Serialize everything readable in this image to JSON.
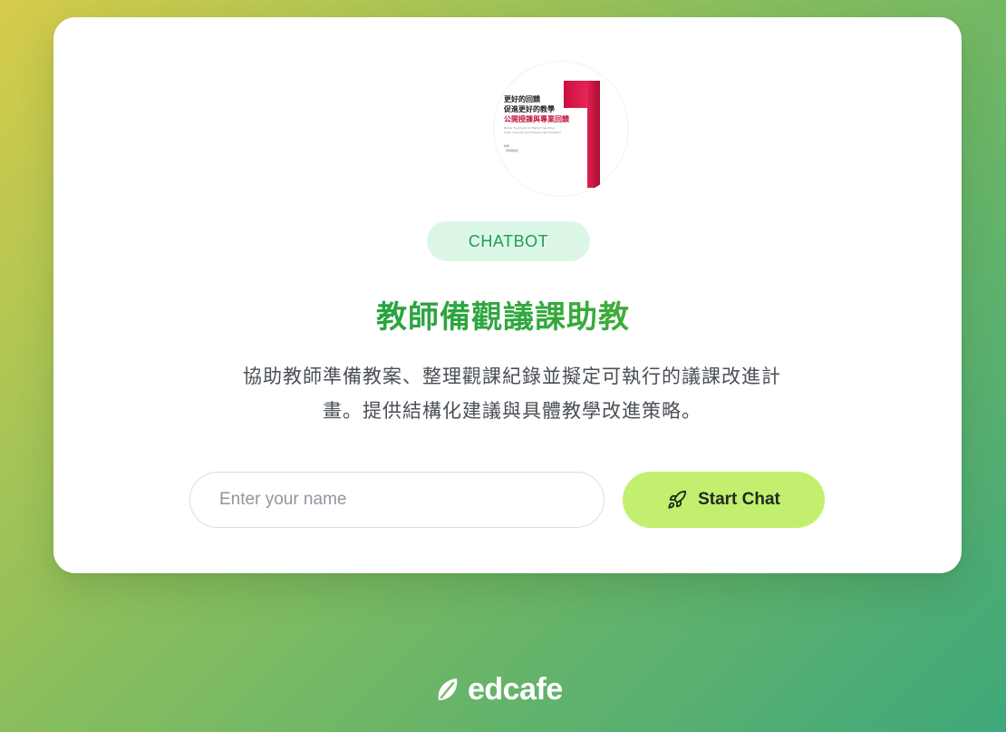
{
  "cover": {
    "line1": "更好的回饋",
    "line2": "促進更好的教學",
    "line3": "公開授課與專業回饋",
    "subtitle1": "Better Feedback for Better Teaching",
    "subtitle2": "Open Lessons and Professional Feedback",
    "author_label": "作者",
    "authors": "（作者姓名）"
  },
  "badge": {
    "label": "CHATBOT"
  },
  "title": "教師備觀議課助教",
  "description": {
    "line1": "協助教師準備教案、整理觀課紀錄並擬定可執行的議課改進計",
    "line2": "畫。提供結構化建議與具體教學改進策略。"
  },
  "name_input": {
    "placeholder": "Enter your name",
    "value": ""
  },
  "start_button": {
    "label": "Start Chat",
    "icon": "rocket-icon"
  },
  "footer": {
    "logo_text": "edcafe",
    "icon": "leaf-icon"
  },
  "colors": {
    "title_green": "#2fa640",
    "badge_bg": "#dcf7e6",
    "badge_text": "#1f9d55",
    "button_bg": "#c2ef6e",
    "cover_red": "#d01848"
  }
}
